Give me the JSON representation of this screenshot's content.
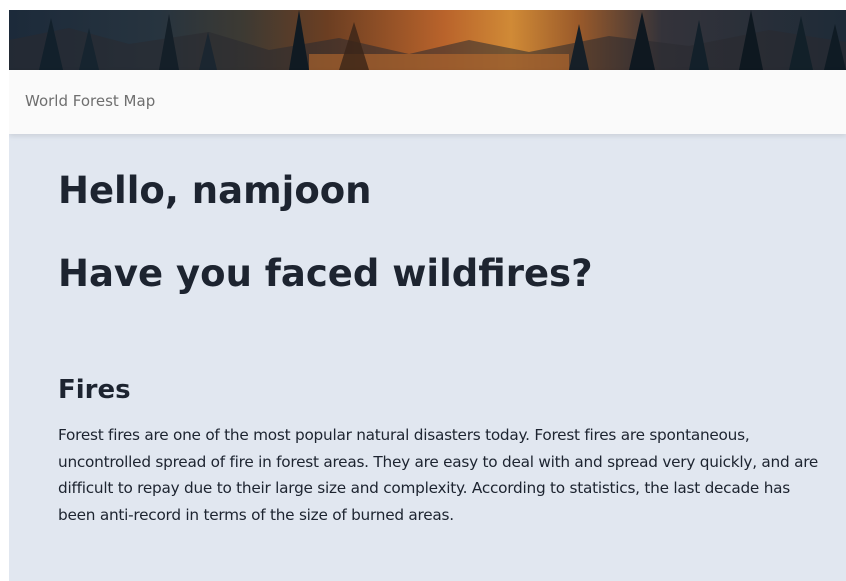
{
  "header": {
    "brand": "World Forest Map"
  },
  "main": {
    "greeting": "Hello, namjoon",
    "question": "Have you faced wildfires?",
    "section": {
      "title": "Fires",
      "text": "Forest fires are one of the most popular natural disasters today. Forest fires are spontaneous, uncontrolled spread of fire in forest areas. They are easy to deal with and spread very quickly, and are difficult to repay due to their large size and complexity. According to statistics, the last decade has been anti-record in terms of the size of burned areas."
    }
  },
  "colors": {
    "background": "#e1e7f0",
    "navbar": "#fafafa",
    "text": "#1d2430",
    "brand_text": "#6f6f6f"
  }
}
